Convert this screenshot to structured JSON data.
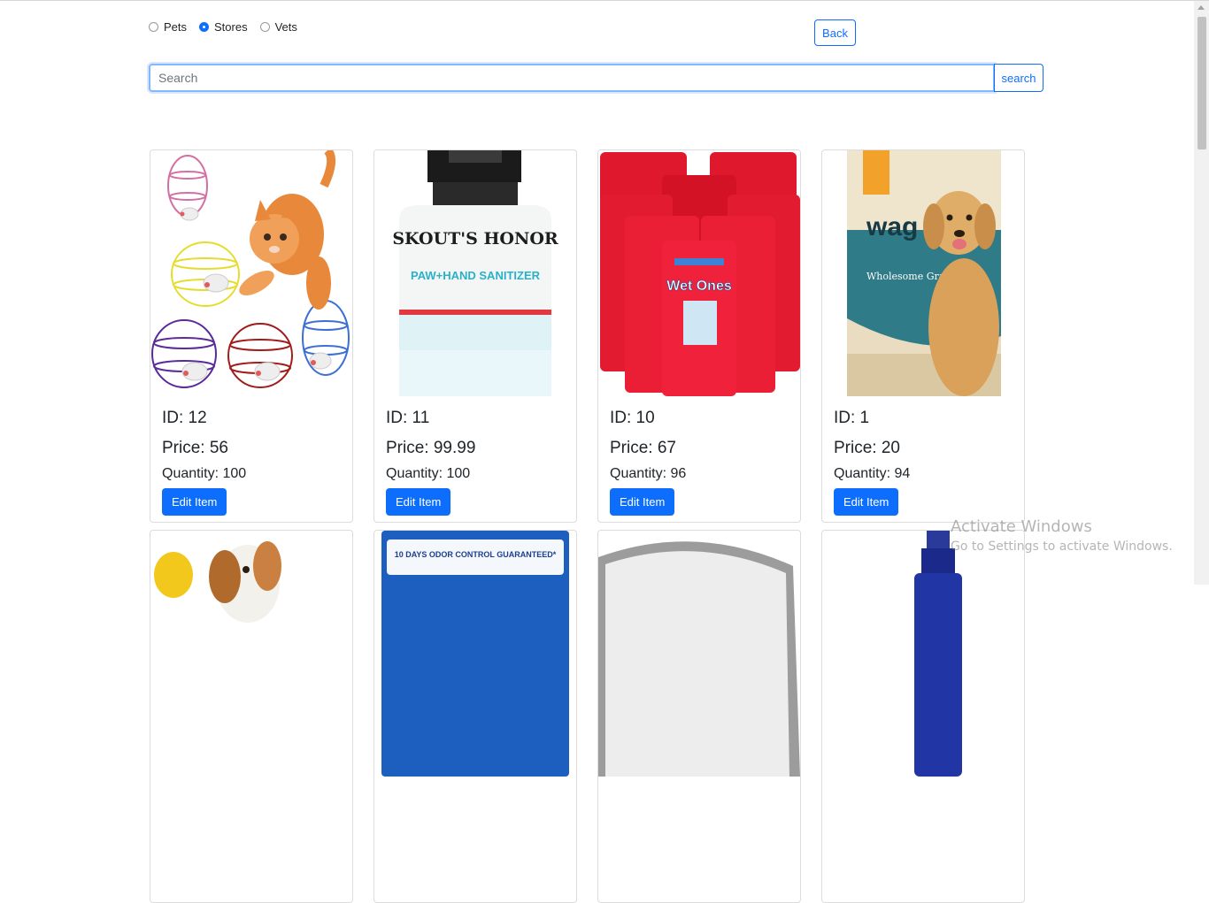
{
  "filters": {
    "options": [
      {
        "label": "Pets",
        "checked": false
      },
      {
        "label": "Stores",
        "checked": true
      },
      {
        "label": "Vets",
        "checked": false
      }
    ]
  },
  "back_label": "Back",
  "search": {
    "placeholder": "Search",
    "button_label": "search"
  },
  "products": [
    {
      "id": "ID: 12",
      "price": "Price: 56",
      "quantity": "Quantity: 100",
      "edit_label": "Edit Item",
      "image": "cat-toys"
    },
    {
      "id": "ID: 11",
      "price": "Price: 99.99",
      "quantity": "Quantity: 100",
      "edit_label": "Edit Item",
      "image": "paw-hand-sanitizer",
      "brand_text": "SKOUT'S HONOR",
      "product_text": "PAW+HAND SANITIZER"
    },
    {
      "id": "ID: 10",
      "price": "Price: 67",
      "quantity": "Quantity: 96",
      "edit_label": "Edit Item",
      "image": "wet-ones-wipes",
      "product_text": "Wet Ones"
    },
    {
      "id": "ID: 1",
      "price": "Price: 20",
      "quantity": "Quantity: 94",
      "edit_label": "Edit Item",
      "image": "wag-dog-food",
      "brand_text": "wag",
      "product_text": "Wholesome Grains"
    }
  ],
  "partial_row": [
    {
      "image": "dog-with-corn"
    },
    {
      "image": "litter-box-product",
      "banner_text": "10 DAYS ODOR CONTROL GUARANTEED*"
    },
    {
      "image": "gray-bed"
    },
    {
      "image": "spray-bottle"
    }
  ],
  "watermark": {
    "title": "Activate Windows",
    "subtitle": "Go to Settings to activate Windows."
  }
}
